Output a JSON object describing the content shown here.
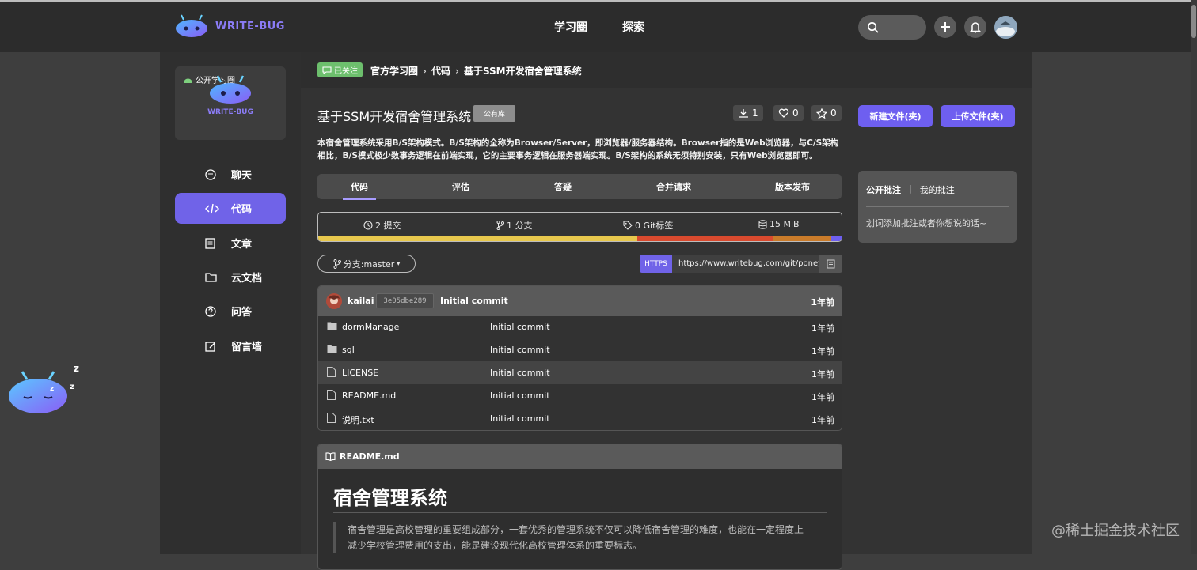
{
  "colors": {
    "accent": "#7063e8",
    "follow_badge": "#6dbf6d",
    "lang_yellow": "#e8c84d",
    "lang_red": "#d94a2e",
    "lang_orange": "#c97b2a",
    "lang_purple": "#6e5ff0"
  },
  "header": {
    "logo_text": "WRITE-BUG",
    "nav": [
      "学习圈",
      "探索"
    ],
    "icons": [
      "search-icon",
      "plus-icon",
      "bell-icon",
      "avatar"
    ]
  },
  "sidebar": {
    "circle_tag": "公开学习圈",
    "circle_logo_text": "WRITE-BUG",
    "items": [
      {
        "label": "聊天",
        "icon": "chat-icon"
      },
      {
        "label": "代码",
        "icon": "code-icon",
        "active": true
      },
      {
        "label": "文章",
        "icon": "article-icon"
      },
      {
        "label": "云文档",
        "icon": "folder-icon"
      },
      {
        "label": "问答",
        "icon": "question-icon"
      },
      {
        "label": "留言墙",
        "icon": "edit-icon"
      }
    ]
  },
  "breadcrumb": {
    "followed_label": "已关注",
    "items": [
      "官方学习圈",
      "代码",
      "基于SSM开发宿舍管理系统"
    ]
  },
  "repo": {
    "title": "基于SSM开发宿舍管理系统",
    "visibility": "公有库",
    "downloads": "1",
    "likes": "0",
    "stars": "0",
    "description": "本宿舍管理系统采用B/S架构模式。B/S架构的全称为Browser/Server，即浏览器/服务器结构。Browser指的是Web浏览器，与C/S架构相比，B/S模式极少数事务逻辑在前端实现，它的主要事务逻辑在服务器端实现。B/S架构的系统无须特别安装，只有Web浏览器即可。"
  },
  "tabs": [
    "代码",
    "评估",
    "答疑",
    "合并请求",
    "版本发布"
  ],
  "stats": {
    "commits": "2 提交",
    "branches": "1 分支",
    "tags": "0 Git标签",
    "size": "15 MiB",
    "lang_share": [
      0.61,
      0.26,
      0.11,
      0.02
    ]
  },
  "branch": {
    "label": "分支:master"
  },
  "clone": {
    "protocol": "HTTPS",
    "url": "https://www.writebug.com/git/poney"
  },
  "latest_commit": {
    "user": "kailai",
    "hash": "3e05dbe289",
    "message": "Initial commit",
    "time": "1年前"
  },
  "files": [
    {
      "name": "dormManage",
      "type": "folder",
      "message": "Initial commit",
      "time": "1年前"
    },
    {
      "name": "sql",
      "type": "folder",
      "message": "Initial commit",
      "time": "1年前"
    },
    {
      "name": "LICENSE",
      "type": "file",
      "message": "Initial commit",
      "time": "1年前"
    },
    {
      "name": "README.md",
      "type": "file",
      "message": "Initial commit",
      "time": "1年前"
    },
    {
      "name": "说明.txt",
      "type": "file",
      "message": "Initial commit",
      "time": "1年前"
    }
  ],
  "readme": {
    "filename": "README.md",
    "heading": "宿舍管理系统",
    "quote": "宿舍管理是高校管理的重要组成部分，一套优秀的管理系统不仅可以降低宿舍管理的难度，也能在一定程度上减少学校管理费用的支出，能是建设现代化高校管理体系的重要标志。"
  },
  "actions": {
    "new_file": "新建文件(夹)",
    "upload_file": "上传文件(夹)"
  },
  "annotations": {
    "tab_public": "公开批注",
    "divider": "|",
    "tab_mine": "我的批注",
    "placeholder": "划词添加批注或者你想说的话~"
  },
  "watermark": "@稀土掘金技术社区"
}
